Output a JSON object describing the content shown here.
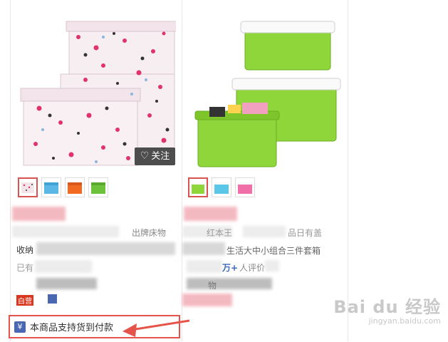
{
  "products": [
    {
      "follow_label": "关注",
      "follow_icon": "heart-outline-icon",
      "title_snippet_right": "出牌床物",
      "title_snippet_line2": "收纳",
      "sales_snippet": "已有",
      "badge": "白营"
    },
    {
      "title_snippet_line1": "红本王",
      "title_snippet_right": "品日有盖",
      "title_snippet_line2": "生活大中小组合三件套箱",
      "review_plus": "万+",
      "review_label": "人评价",
      "sales_snippet": "物"
    }
  ],
  "cod": {
    "text": "本商品支持货到付款",
    "icon": "cod-icon"
  },
  "watermark": {
    "main": "Bai du 经验",
    "sub": "jingyan.baidu.com"
  },
  "colors": {
    "highlight_red": "#e6534a",
    "follow_bg": "#4d4d4d",
    "box_pink": "#f2e6ec",
    "box_green": "#8fd63a"
  }
}
